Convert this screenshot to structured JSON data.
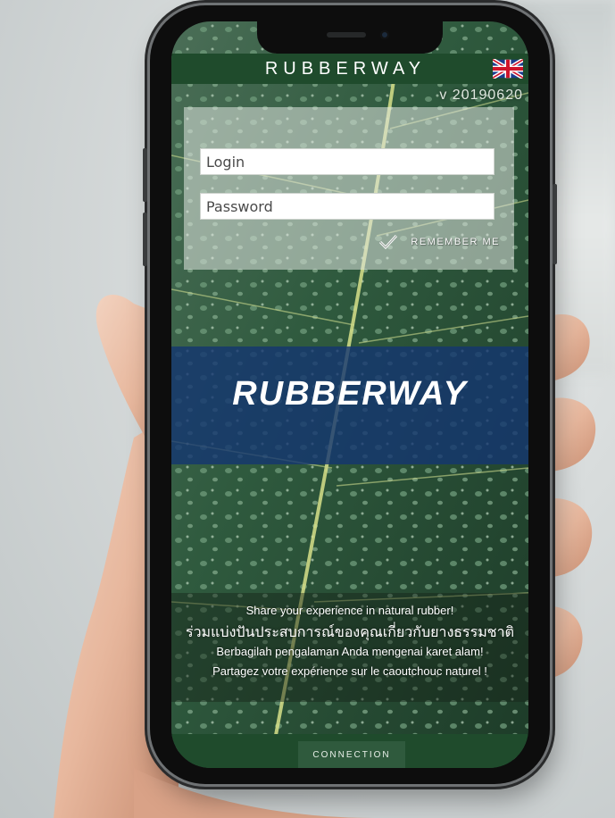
{
  "app": {
    "title": "RUBBERWAY",
    "version": "v 20190620",
    "language_flag": "uk-flag-icon"
  },
  "login": {
    "login_placeholder": "Login",
    "password_placeholder": "Password",
    "remember_label": "REMEMBER ME",
    "remember_checked": true
  },
  "brand": {
    "logo_text": "RUBBERWAY"
  },
  "tagline": {
    "english": "Share your experience in natural rubber!",
    "thai": "ร่วมแบ่งปันประสบการณ์ของคุณเกี่ยวกับยางธรรมชาติ",
    "indonesian": "Berbagilah pengalaman Anda mengenai karet alam!",
    "french": "Partagez votre expérience sur le caoutchouc naturel !"
  },
  "actions": {
    "connect_label": "CONNECTION"
  },
  "colors": {
    "header_green": "#1f4b2c",
    "brand_blue": "#143670",
    "button_green": "#2f5a3d"
  }
}
